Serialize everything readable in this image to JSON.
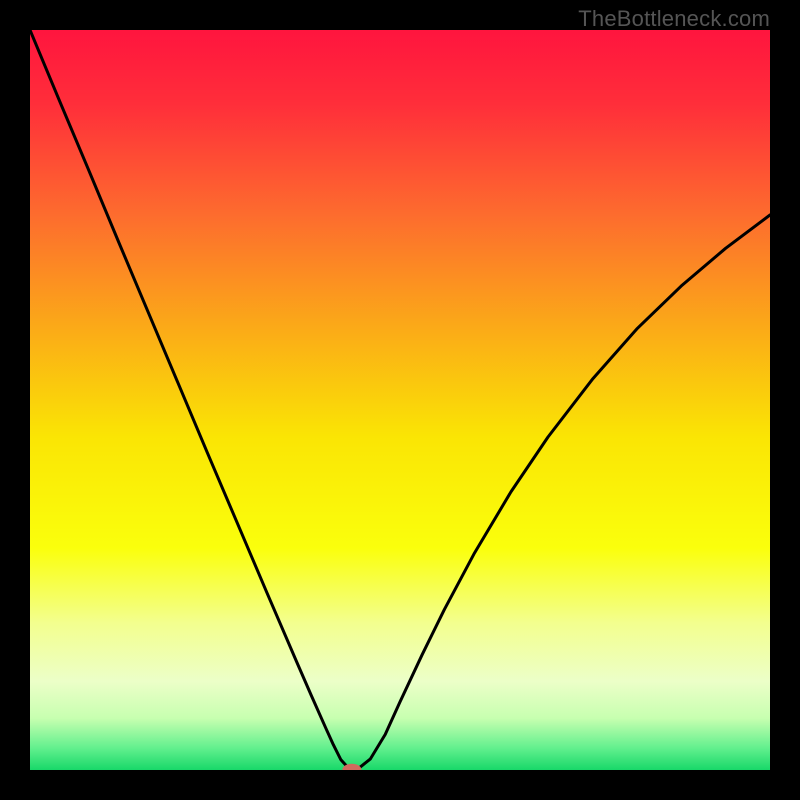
{
  "watermark": "TheBottleneck.com",
  "chart_data": {
    "type": "line",
    "title": "",
    "xlabel": "",
    "ylabel": "",
    "xlim": [
      0,
      100
    ],
    "ylim": [
      0,
      100
    ],
    "background_gradient": {
      "stops": [
        {
          "offset": 0.0,
          "color": "#ff153e"
        },
        {
          "offset": 0.1,
          "color": "#ff2e3a"
        },
        {
          "offset": 0.25,
          "color": "#fd6c2e"
        },
        {
          "offset": 0.4,
          "color": "#fba918"
        },
        {
          "offset": 0.55,
          "color": "#fae504"
        },
        {
          "offset": 0.7,
          "color": "#faff0c"
        },
        {
          "offset": 0.8,
          "color": "#f3ff8d"
        },
        {
          "offset": 0.88,
          "color": "#ecffc8"
        },
        {
          "offset": 0.93,
          "color": "#c7ffb0"
        },
        {
          "offset": 0.97,
          "color": "#63f08e"
        },
        {
          "offset": 1.0,
          "color": "#18d869"
        }
      ]
    },
    "series": [
      {
        "name": "bottleneck-curve",
        "color": "#000000",
        "x": [
          0.0,
          4.0,
          8.0,
          12.0,
          16.0,
          20.0,
          24.0,
          28.0,
          32.0,
          36.0,
          38.0,
          40.0,
          41.0,
          42.0,
          43.0,
          44.5,
          46.0,
          48.0,
          50.0,
          53.0,
          56.0,
          60.0,
          65.0,
          70.0,
          76.0,
          82.0,
          88.0,
          94.0,
          100.0
        ],
        "y": [
          100.0,
          90.4,
          80.9,
          71.3,
          61.8,
          52.3,
          42.8,
          33.4,
          24.0,
          14.7,
          10.1,
          5.6,
          3.4,
          1.4,
          0.3,
          0.3,
          1.5,
          4.8,
          9.2,
          15.6,
          21.7,
          29.2,
          37.6,
          45.0,
          52.8,
          59.6,
          65.4,
          70.5,
          75.0
        ]
      }
    ],
    "marker": {
      "name": "optimal-point",
      "x": 43.5,
      "y": 0.0,
      "rx": 1.3,
      "ry": 0.85,
      "fill": "#cf6a5e"
    }
  }
}
